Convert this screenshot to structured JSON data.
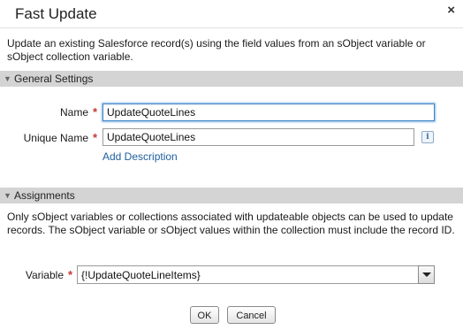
{
  "dialog": {
    "title": "Fast Update",
    "close_symbol": "×",
    "description": "Update an existing Salesforce record(s) using the field values from an sObject variable or sObject collection variable."
  },
  "general_settings": {
    "header": "General Settings",
    "name": {
      "label": "Name",
      "value": "UpdateQuoteLines"
    },
    "unique_name": {
      "label": "Unique Name",
      "value": "UpdateQuoteLines"
    },
    "info_symbol": "i",
    "add_description": "Add Description"
  },
  "assignments": {
    "header": "Assignments",
    "description": "Only sObject variables or collections associated with updateable objects can be used to update records. The sObject variable or sObject values within the collection must include the record ID.",
    "variable": {
      "label": "Variable",
      "value": "{!UpdateQuoteLineItems}"
    }
  },
  "buttons": {
    "ok": "OK",
    "cancel": "Cancel"
  },
  "required_marker": "*",
  "collapse_marker": "▼",
  "icons": {
    "close": "close-icon",
    "info": "info-icon",
    "collapse": "triangle-down-icon",
    "dropdown": "chevron-down-icon"
  },
  "colors": {
    "section_header_bg": "#d4d4d4",
    "required_star": "#c23934",
    "link": "#1f5fa0",
    "focus_border": "#3f84c5"
  }
}
